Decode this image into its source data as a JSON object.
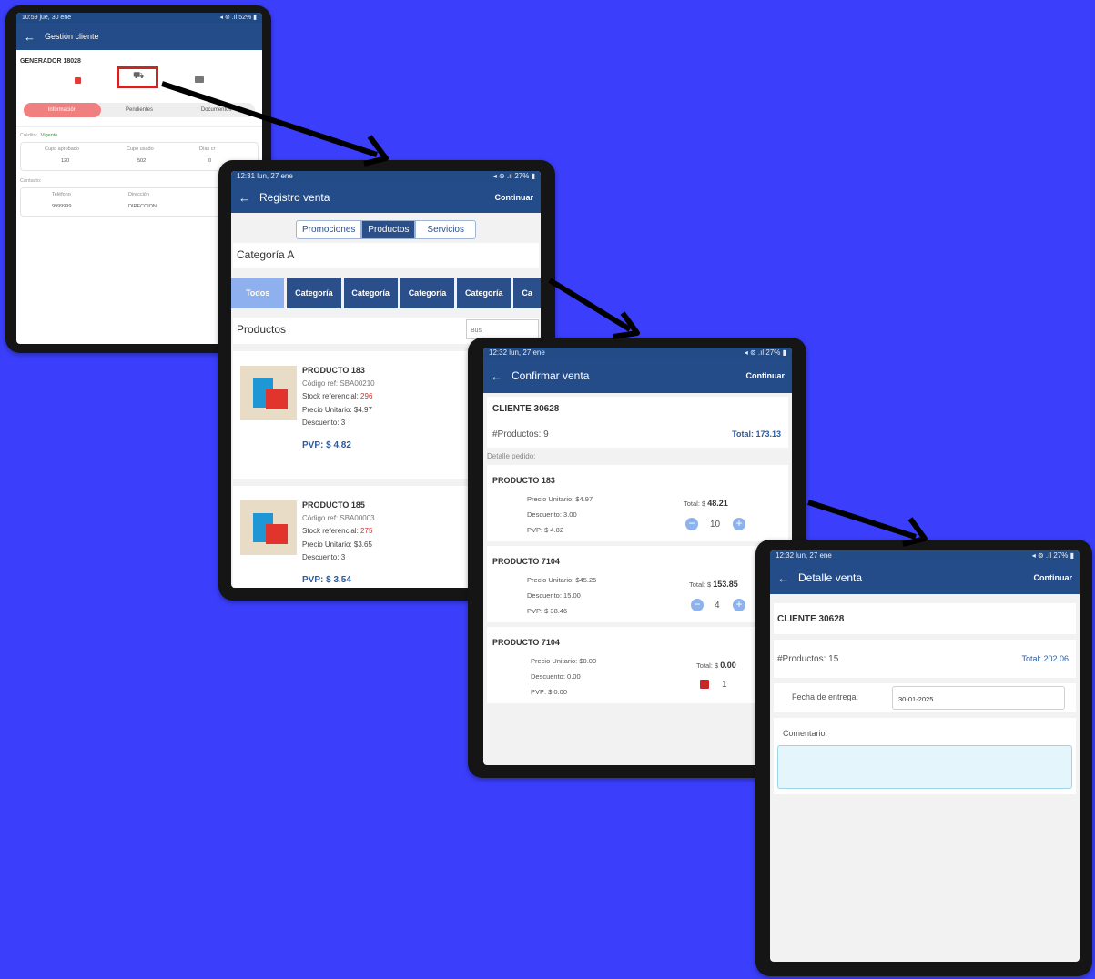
{
  "colors": {
    "background": "#3b3ffb",
    "appbar": "#244c88",
    "accent": "#f08080",
    "link": "#2c5aa0",
    "stock": "#d32f2f",
    "highlight": "#c62828"
  },
  "screen1": {
    "status_time": "10:59  jue, 30 ene",
    "status_right": "◂ ⊚ .ıl 52% ▮",
    "title": "Gestión cliente",
    "client": "GENERADOR 18028",
    "tabs": [
      "Información",
      "Pendientes",
      "Documentos"
    ],
    "credit_label": "Crédito:",
    "credit_value": "Vigente",
    "cols": [
      "Cupo aprobado",
      "Cupo usado",
      "Días cr"
    ],
    "vals": [
      "120",
      "502",
      "0"
    ],
    "contact_label": "Contacto:",
    "contact_cols": [
      "Teléfono",
      "Dirección"
    ],
    "contact_vals": [
      "9999999",
      "DIRECCION"
    ]
  },
  "screen2": {
    "status_time": "12:31  lun, 27 ene",
    "status_right": "◂ ⊚ .ıl 27% ▮",
    "title": "Registro venta",
    "continue": "Continuar",
    "segments": [
      "Promociones",
      "Productos",
      "Servicios"
    ],
    "category_title": "Categoría A",
    "categories": [
      "Todos",
      "Categoría",
      "Categoría",
      "Categoría",
      "Categoría",
      "Ca"
    ],
    "products_title": "Productos",
    "search_placeholder": "Bus",
    "products": [
      {
        "name": "PRODUCTO 183",
        "code": "Código ref: SBA00210",
        "stock_label": "Stock referencial:",
        "stock": "296",
        "price": "Precio Unitario: $4.97",
        "discount": "Descuento: 3",
        "pvp": "PVP: $ 4.82"
      },
      {
        "name": "PRODUCTO 185",
        "code": "Código ref: SBA00003",
        "stock_label": "Stock referencial:",
        "stock": "275",
        "price": "Precio Unitario: $3.65",
        "discount": "Descuento: 3",
        "pvp": "PVP: $ 3.54"
      }
    ]
  },
  "screen3": {
    "status_time": "12:32  lun, 27 ene",
    "status_right": "◂ ⊚ .ıl 27% ▮",
    "title": "Confirmar venta",
    "continue": "Continuar",
    "client": "CLIENTE 30628",
    "count": "#Productos: 9",
    "total": "Total: 173.13",
    "detail_label": "Detalle pedido:",
    "items": [
      {
        "name": "PRODUCTO 183",
        "price": "Precio Unitario: $4.97",
        "discount": "Descuento: 3.00",
        "pvp": "PVP: $ 4.82",
        "total_label": "Total: $",
        "total": "48.21",
        "qty": "10"
      },
      {
        "name": "PRODUCTO 7104",
        "price": "Precio Unitario: $45.25",
        "discount": "Descuento: 15.00",
        "pvp": "PVP: $ 38.46",
        "total_label": "Total: $",
        "total": "153.85",
        "qty": "4"
      },
      {
        "name": "PRODUCTO 7104",
        "price": "Precio Unitario: $0.00",
        "discount": "Descuento: 0.00",
        "pvp": "PVP: $ 0.00",
        "total_label": "Total: $",
        "total": "0.00",
        "qty": "1"
      }
    ]
  },
  "screen4": {
    "status_time": "12:32  lun, 27 ene",
    "status_right": "◂ ⊚ .ıl 27% ▮",
    "title": "Detalle venta",
    "continue": "Continuar",
    "client": "CLIENTE 30628",
    "count": "#Productos: 15",
    "total": "Total: 202.06",
    "date_label": "Fecha de entrega:",
    "date_value": "30-01-2025",
    "comment_label": "Comentario:"
  }
}
